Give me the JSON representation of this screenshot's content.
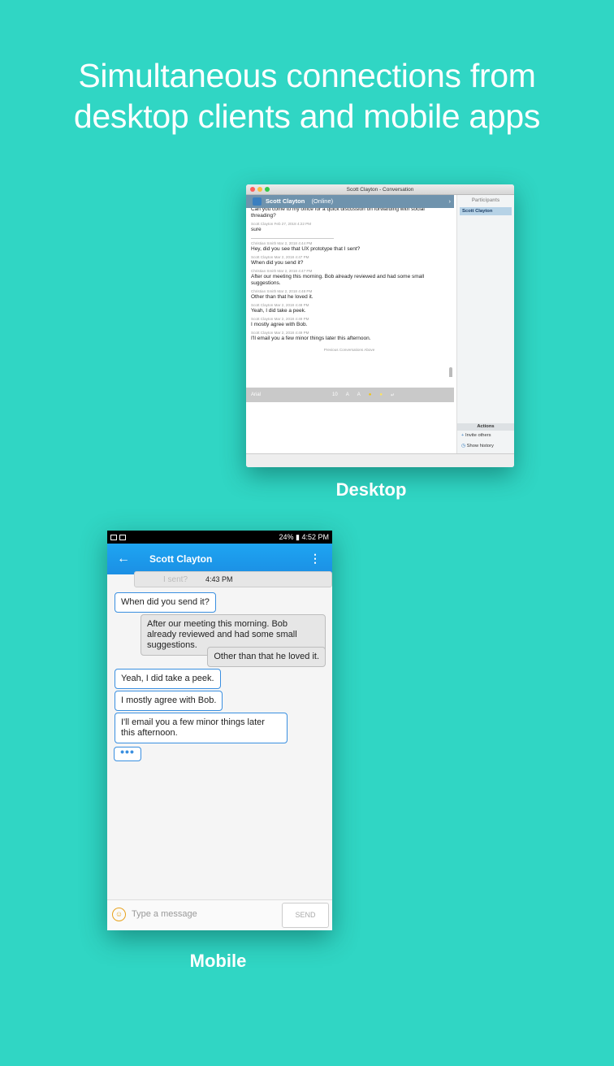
{
  "headline": {
    "line1": "Simultaneous connections from",
    "line2": "desktop clients and mobile apps"
  },
  "desktop": {
    "label": "Desktop",
    "window_title": "Scott Clayton - Conversation",
    "contact_name": "Scott Clayton",
    "contact_status": "(Online)",
    "messages": [
      {
        "meta": "",
        "text": "Can you come to my office for a quick discussion on forwarding with social threading?"
      },
      {
        "meta": "Scott Clayton Feb 27, 2018 4:22 PM",
        "text": "sure"
      },
      {
        "meta": "Christian Smith Mar 2, 2018 4:44 PM",
        "text": "Hey, did you see that UX prototype that I sent?"
      },
      {
        "meta": "Scott Clayton Mar 2, 2018 4:47 PM",
        "text": "When did you send it?"
      },
      {
        "meta": "Christian Smith Mar 2, 2018 4:47 PM",
        "text": "After our meeting this morning. Bob already reviewed and had some small suggestions."
      },
      {
        "meta": "Christian Smith Mar 2, 2018 4:48 PM",
        "text": "Other than that he loved it."
      },
      {
        "meta": "Scott Clayton Mar 2, 2018 4:48 PM",
        "text": "Yeah, I did take a peek."
      },
      {
        "meta": "Scott Clayton Mar 2, 2018 4:49 PM",
        "text": "I mostly agree with Bob."
      },
      {
        "meta": "Scott Clayton Mar 2, 2018 4:49 PM",
        "text": "I'll email you a few minor things later this afternoon."
      }
    ],
    "previous_conversations": "Previous Conversations Above",
    "font_name": "Arial",
    "font_size": "10",
    "participants_header": "Participants",
    "participant": "Scott Clayton",
    "actions_label": "Actions",
    "invite_label": "Invite others",
    "history_label": "Show history"
  },
  "mobile": {
    "label": "Mobile",
    "status_right": "24% ▮ 4:52 PM",
    "contact_name": "Scott Clayton",
    "prev_text": "I sent?",
    "prev_time": "4:43 PM",
    "bubbles": [
      {
        "dir": "in",
        "text": "When did you send it?"
      },
      {
        "dir": "out",
        "text": "After our meeting this morning. Bob already reviewed and had some small suggestions."
      },
      {
        "dir": "out",
        "text": "Other than that he loved it."
      },
      {
        "dir": "in",
        "text": "Yeah, I did take a peek."
      },
      {
        "dir": "in",
        "text": "I mostly agree with Bob."
      },
      {
        "dir": "in",
        "text": "I'll email you a few minor things later this afternoon."
      }
    ],
    "typing": "•••",
    "input_placeholder": "Type a message",
    "send_label": "SEND"
  }
}
